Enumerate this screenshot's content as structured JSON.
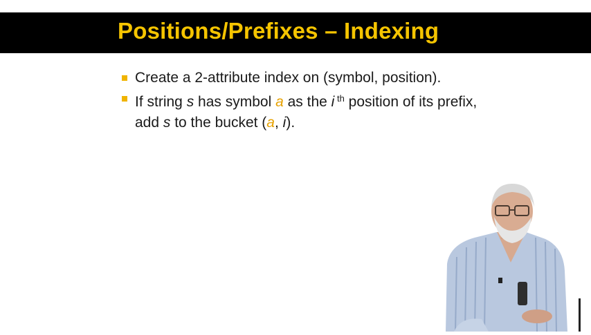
{
  "slide": {
    "title": "Positions/Prefixes – Indexing",
    "bullet1": {
      "text": "Create a 2-attribute index on (symbol, position)."
    },
    "bullet2": {
      "t1": "If string ",
      "s1": "s",
      "t2": " has symbol ",
      "a1": "a",
      "t3": " as the ",
      "i1": "i",
      "sup": " th",
      "t4": " position of its prefix, add ",
      "s2": "s",
      "t5": " to the bucket (",
      "a2": "a",
      "t6": ", ",
      "i2": "i",
      "t7": ")."
    }
  },
  "colors": {
    "title_bar": "#000000",
    "title_text": "#f5c400",
    "bullet_marker": "#f0b400",
    "highlight_variable": "#e6a100"
  },
  "presenter": {
    "icon": "presenter-video-figure"
  }
}
